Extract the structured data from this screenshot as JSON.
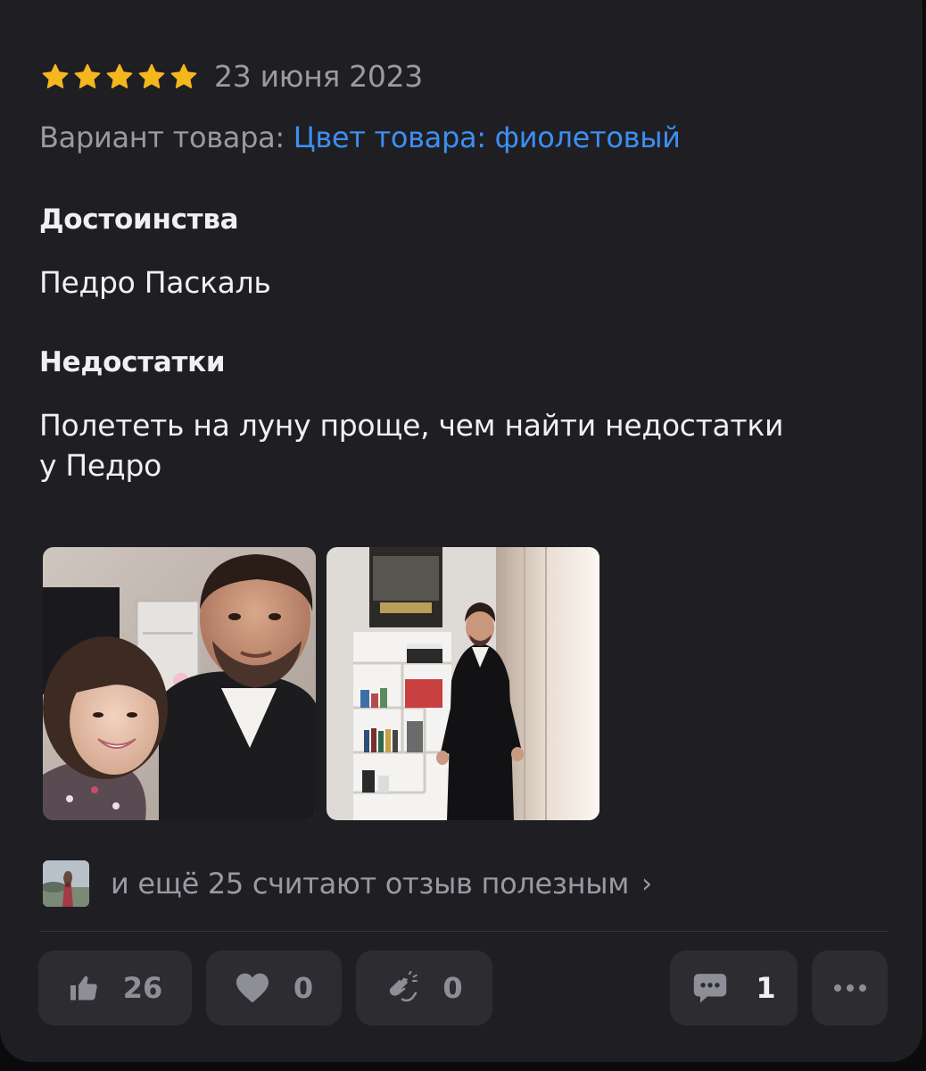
{
  "review": {
    "rating": 5,
    "date": "23 июня 2023",
    "variant_label": "Вариант товара: ",
    "variant_value": "Цвет товара: фиолетовый",
    "pros_heading": "Достоинства",
    "pros_text": "Педро Паскаль",
    "cons_heading": "Недостатки",
    "cons_text_line1": "Полететь на луну проще, чем найти недостатки",
    "cons_text_line2": "у Педро"
  },
  "helpful": {
    "text": "и ещё 25 считают отзыв полезным",
    "chevron": "›"
  },
  "actions": {
    "likes": "26",
    "hearts": "0",
    "claps": "0",
    "comments": "1"
  },
  "colors": {
    "star": "#f5b71e",
    "link": "#3d8ff2",
    "background": "#1f1f23",
    "button": "#2c2c31"
  },
  "icons": {
    "star": "star-icon",
    "like": "thumbs-up-icon",
    "heart": "heart-icon",
    "clap": "clapping-hands-icon",
    "comment": "comment-bubble-icon",
    "more": "more-dots-icon",
    "chevron": "chevron-right-icon"
  }
}
